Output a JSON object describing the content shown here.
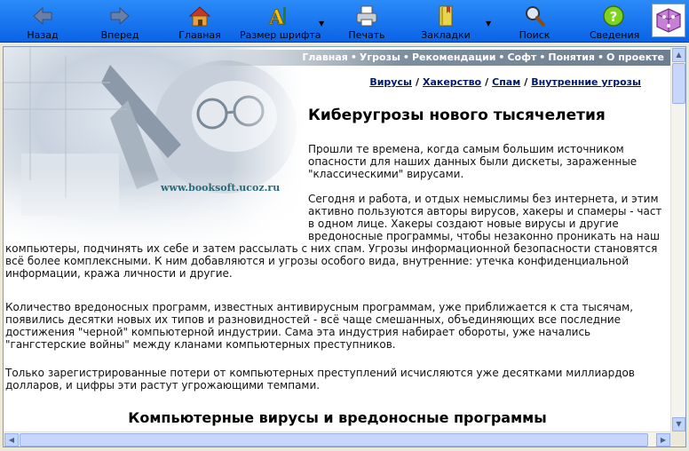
{
  "toolbar": {
    "back": "Назад",
    "forward": "Вперед",
    "home": "Главная",
    "font_size": "Размер шрифта",
    "print": "Печать",
    "bookmarks": "Закладки",
    "search": "Поиск",
    "info": "Сведения"
  },
  "header": {
    "site_url": "www.booksoft.ucoz.ru",
    "nav": [
      "Главная",
      "Угрозы",
      "Рекомендации",
      "Софт",
      "Понятия",
      "О проекте"
    ],
    "nav_separator": "•"
  },
  "breadcrumbs": [
    "Вирусы",
    "Хакерство",
    "Спам",
    "Внутренние угрозы"
  ],
  "breadcrumb_separator": "/",
  "article": {
    "title": "Киберугрозы нового тысячелетия",
    "p1": "Прошли те времена, когда самым большим источником опасности для наших данных были дискеты, зараженные \"классическими\" вирусами.",
    "p2_right": "Сегодня и работа, и отдых немыслимы без интернета, и этим активно пользуются авторы вирусов, хакеры и спамеры - част в одном лице. Хакеры создают новые вирусы и другие вредоносные программы, чтобы незаконно проникать на наш",
    "p2_rest": "компьютеры, подчинять их себе и затем рассылать с них спам. Угрозы информационной безопасности становятся всё более комплексными. К ним добавляются и угрозы особого вида, внутренние: утечка конфиденциальной информации, кража личности и другие.",
    "p3": "Количество вредоносных программ, известных антивирусным программам, уже приближается к ста тысячам, появились десятки новых их типов и разновидностей - всё чаще смешанных, объединяющих все последние достижения \"черной\" компьютерной индустрии. Сама эта индустрия набирает обороты, уже начались \"гангстерские войны\" между кланами компьютерных преступников.",
    "p4": "Только зарегистрированные потери от компьютерных преступлений исчисляются уже десятками миллиардов долларов, и цифры эти растут угрожающими темпами.",
    "subtitle": "Компьютерные вирусы и вредоносные программы"
  },
  "colors": {
    "toolbar_blue": "#0a63e6",
    "link": "#001a66",
    "site_url": "#2a6a7a"
  }
}
